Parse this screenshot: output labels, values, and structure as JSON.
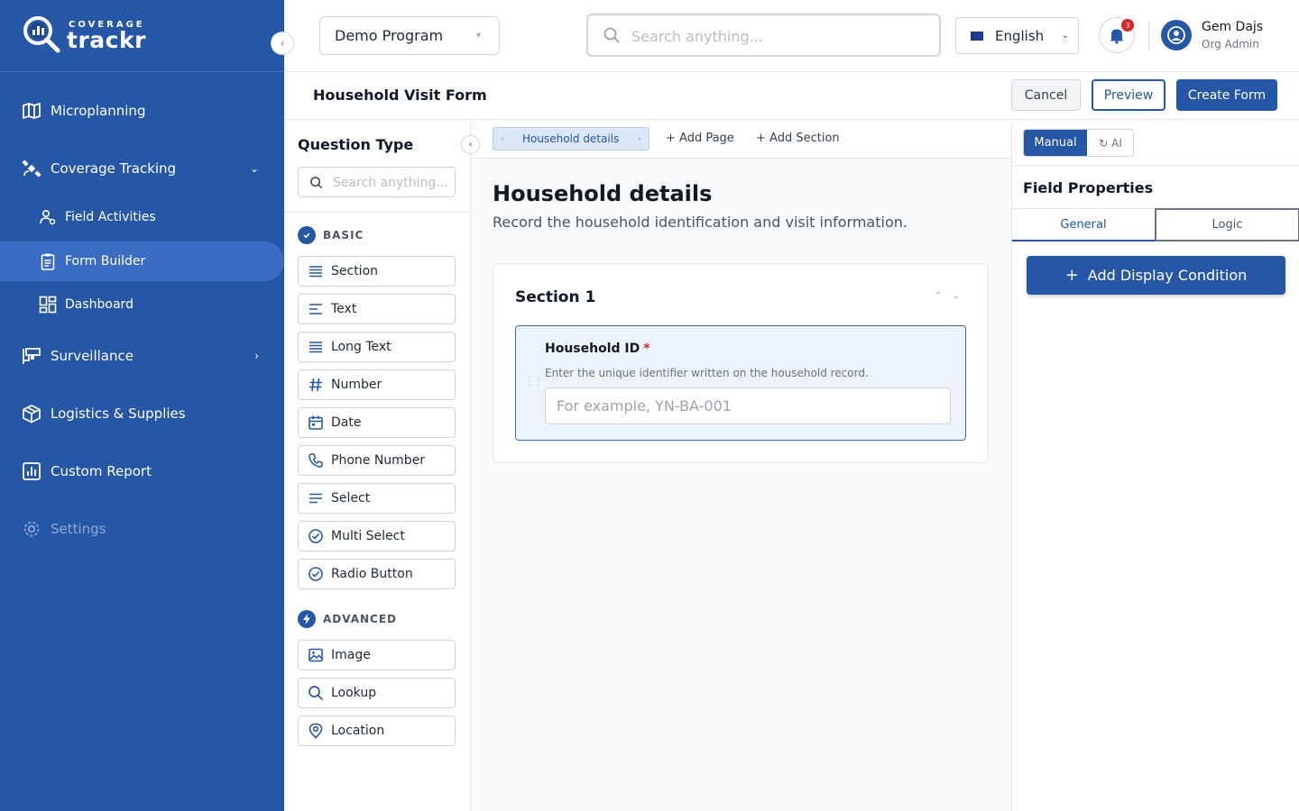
{
  "brand": {
    "tagline": "COVERAGE",
    "name": "trackr"
  },
  "colors": {
    "primary": "#2656a6",
    "sidebar_active": "#3b6cc4",
    "danger": "#dc2626"
  },
  "sidebar": {
    "collapse_icon": "chevron-left-icon",
    "items": [
      {
        "label": "Microplanning",
        "icon": "map-icon"
      },
      {
        "label": "Coverage Tracking",
        "icon": "satellite-icon",
        "expanded": true
      },
      {
        "label": "Field Activities",
        "icon": "users-icon"
      },
      {
        "label": "Form Builder",
        "icon": "clipboard-icon",
        "active": true
      },
      {
        "label": "Dashboard",
        "icon": "dashboard-icon"
      },
      {
        "label": "Surveillance",
        "icon": "cctv-icon"
      },
      {
        "label": "Logistics & Supplies",
        "icon": "box-icon"
      },
      {
        "label": "Custom Report",
        "icon": "report-icon"
      },
      {
        "label": "Settings",
        "icon": "gear-icon",
        "disabled": true
      }
    ]
  },
  "topbar": {
    "program": "Demo Program",
    "search_placeholder": "Search anything...",
    "language": "English",
    "notifications_count": "3",
    "user_name": "Gem Dajs",
    "user_role": "Org Admin"
  },
  "form": {
    "title": "Household Visit Form",
    "cancel_label": "Cancel",
    "preview_label": "Preview",
    "create_label": "Create Form"
  },
  "question_panel": {
    "title": "Question Type",
    "search_placeholder": "Search anything...",
    "basic_label": "BASIC",
    "basic": [
      {
        "label": "Section",
        "icon": "section-icon"
      },
      {
        "label": "Text",
        "icon": "text-icon"
      },
      {
        "label": "Long Text",
        "icon": "long-text-icon"
      },
      {
        "label": "Number",
        "icon": "hash-icon"
      },
      {
        "label": "Date",
        "icon": "calendar-icon"
      },
      {
        "label": "Phone Number",
        "icon": "phone-icon"
      },
      {
        "label": "Select",
        "icon": "select-icon"
      },
      {
        "label": "Multi Select",
        "icon": "check-circle-icon"
      },
      {
        "label": "Radio Button",
        "icon": "check-circle-icon"
      }
    ],
    "advanced_label": "ADVANCED",
    "advanced": [
      {
        "label": "Image",
        "icon": "image-icon"
      },
      {
        "label": "Lookup",
        "icon": "search-icon"
      },
      {
        "label": "Location",
        "icon": "location-pin-icon"
      }
    ]
  },
  "canvas": {
    "breadcrumb": "Household details",
    "add_page": "Add Page",
    "add_section": "Add Section",
    "page_title": "Household details",
    "page_desc": "Record the household identification and visit information.",
    "section_title": "Section 1",
    "field": {
      "label": "Household ID",
      "required_mark": "*",
      "help": "Enter the unique identifier written on the household record.",
      "placeholder": "For example, YN-BA-001"
    }
  },
  "properties": {
    "mode_manual": "Manual",
    "mode_ai": "AI",
    "title": "Field Properties",
    "tab_general": "General",
    "tab_logic": "Logic",
    "add_condition": "Add Display Condition"
  }
}
